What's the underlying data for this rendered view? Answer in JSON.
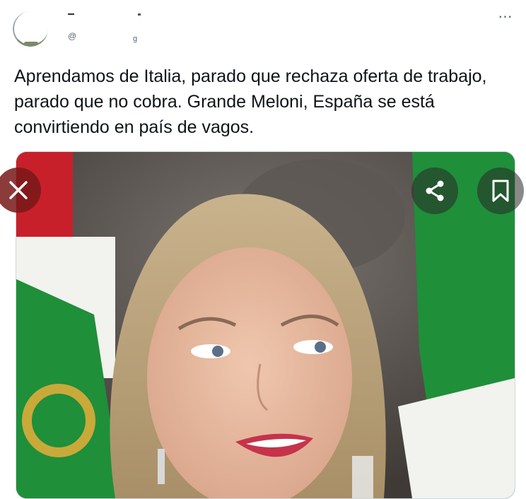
{
  "author": {
    "handle_prefix": "@",
    "handle_tail": "g"
  },
  "more_icon": "⋯",
  "tweet": {
    "text": "Aprendamos de Italia, parado que rechaza oferta de trabajo, parado que no cobra. Grande Meloni, España se está convirtiendo en país de vagos."
  },
  "media": {
    "icons": [
      "close-icon",
      "share-icon",
      "bookmark-icon"
    ],
    "colors": {
      "flag_green": "#1f8f3a",
      "flag_white": "#f2f2ee",
      "flag_red": "#c8202a"
    }
  }
}
